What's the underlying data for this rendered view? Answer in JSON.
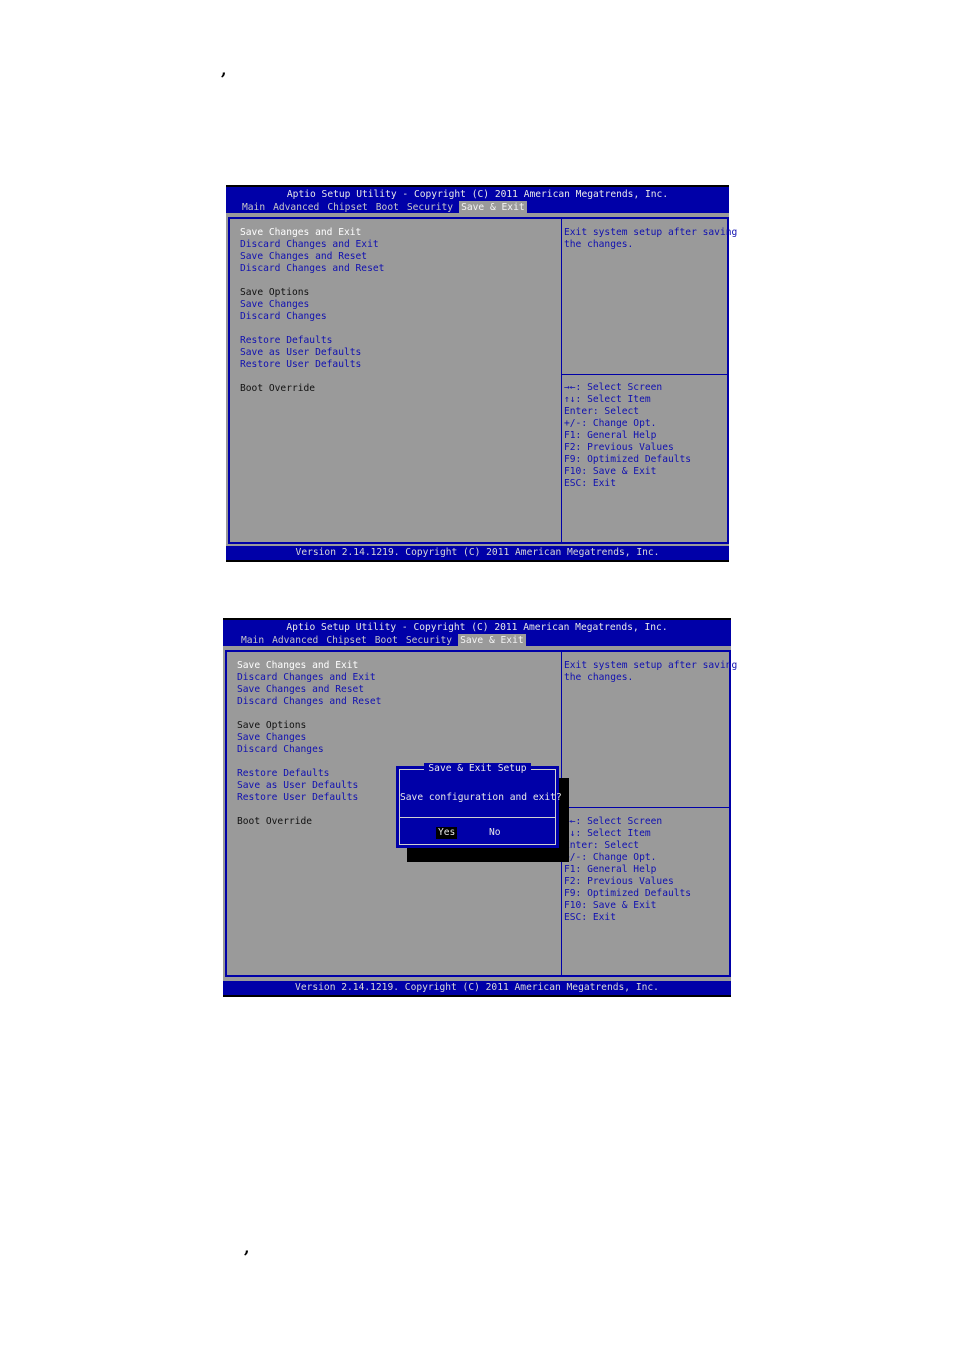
{
  "marks": {
    "top": ",",
    "bottom": ","
  },
  "screens": [
    {
      "title": "Aptio Setup Utility - Copyright (C) 2011 American Megatrends, Inc.",
      "tabs": [
        {
          "label": "Main",
          "active": false
        },
        {
          "label": "Advanced",
          "active": false
        },
        {
          "label": "Chipset",
          "active": false
        },
        {
          "label": "Boot",
          "active": false
        },
        {
          "label": "Security",
          "active": false
        },
        {
          "label": "Save & Exit",
          "active": true
        }
      ],
      "items": [
        {
          "label": "Save Changes and Exit",
          "type": "selected"
        },
        {
          "label": "Discard Changes and Exit",
          "type": "option"
        },
        {
          "label": "Save Changes and Reset",
          "type": "option"
        },
        {
          "label": "Discard Changes and Reset",
          "type": "option"
        },
        {
          "label": "Save Options",
          "type": "header"
        },
        {
          "label": "Save Changes",
          "type": "option"
        },
        {
          "label": "Discard Changes",
          "type": "option"
        },
        {
          "label": "Restore Defaults",
          "type": "option"
        },
        {
          "label": "Save as User Defaults",
          "type": "option"
        },
        {
          "label": "Restore User Defaults",
          "type": "option"
        },
        {
          "label": "Boot Override",
          "type": "header"
        }
      ],
      "help": [
        "Exit system setup after saving",
        "the changes."
      ],
      "keys": [
        "→←: Select Screen",
        "↑↓: Select Item",
        "Enter: Select",
        "+/-: Change Opt.",
        "F1: General Help",
        "F2: Previous Values",
        "F9: Optimized Defaults",
        "F10: Save & Exit",
        "ESC: Exit"
      ],
      "footer": "Version 2.14.1219. Copyright (C) 2011 American Megatrends, Inc."
    },
    {
      "title": "Aptio Setup Utility - Copyright (C) 2011 American Megatrends, Inc.",
      "tabs": [
        {
          "label": "Main",
          "active": false
        },
        {
          "label": "Advanced",
          "active": false
        },
        {
          "label": "Chipset",
          "active": false
        },
        {
          "label": "Boot",
          "active": false
        },
        {
          "label": "Security",
          "active": false
        },
        {
          "label": "Save & Exit",
          "active": true
        }
      ],
      "items": [
        {
          "label": "Save Changes and Exit",
          "type": "selected"
        },
        {
          "label": "Discard Changes and Exit",
          "type": "option"
        },
        {
          "label": "Save Changes and Reset",
          "type": "option"
        },
        {
          "label": "Discard Changes and Reset",
          "type": "option"
        },
        {
          "label": "Save Options",
          "type": "header"
        },
        {
          "label": "Save Changes",
          "type": "option"
        },
        {
          "label": "Discard Changes",
          "type": "option"
        },
        {
          "label": "Restore Defaults",
          "type": "option"
        },
        {
          "label": "Save as User Defaults",
          "type": "option"
        },
        {
          "label": "Restore User Defaults",
          "type": "option"
        },
        {
          "label": "Boot Override",
          "type": "header"
        }
      ],
      "help": [
        "Exit system setup after saving",
        "the changes."
      ],
      "keys": [
        "→←: Select Screen",
        "↑↓: Select Item",
        "Enter: Select",
        "+/-: Change Opt.",
        "F1: General Help",
        "F2: Previous Values",
        "F9: Optimized Defaults",
        "F10: Save & Exit",
        "ESC: Exit"
      ],
      "footer": "Version 2.14.1219. Copyright (C) 2011 American Megatrends, Inc.",
      "dialog": {
        "title": "Save & Exit Setup",
        "message": "Save configuration and exit?",
        "yes": "Yes",
        "no": "No",
        "focused": "yes"
      }
    }
  ]
}
